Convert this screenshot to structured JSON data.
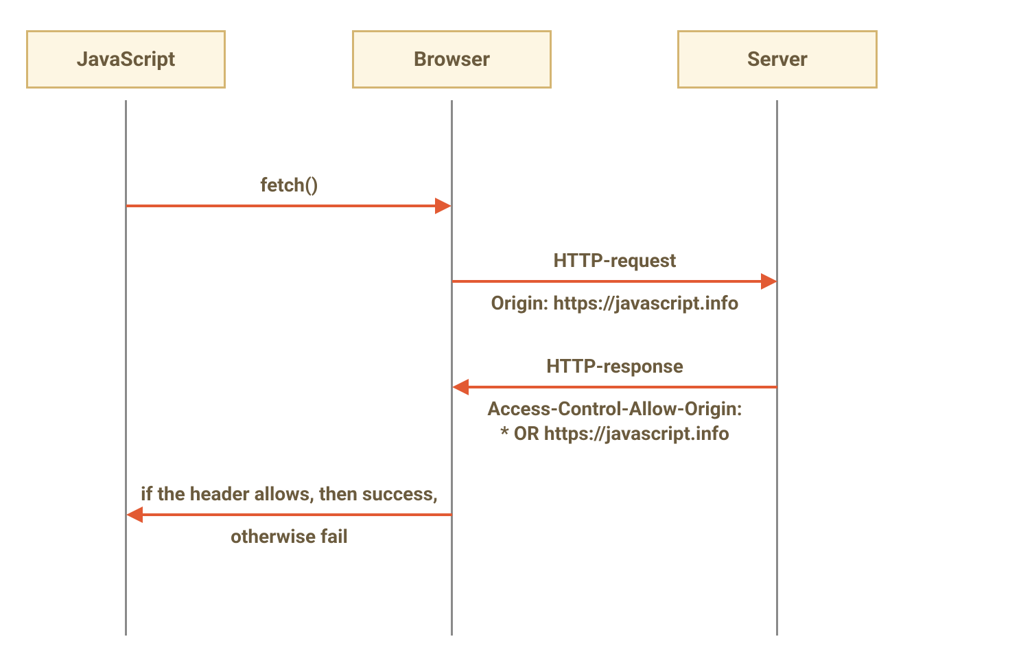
{
  "actors": {
    "javascript": "JavaScript",
    "browser": "Browser",
    "server": "Server"
  },
  "messages": {
    "fetch": "fetch()",
    "http_request": "HTTP-request",
    "origin": "Origin: https://javascript.info",
    "http_response": "HTTP-response",
    "acao_line1": "Access-Control-Allow-Origin:",
    "acao_line2": "* OR https://javascript.info",
    "success_line1": "if the header allows, then success,",
    "success_line2": "otherwise fail"
  },
  "colors": {
    "box_bg": "#fdf6e3",
    "box_border": "#d4b572",
    "text": "#6b5b3e",
    "arrow": "#e25a33",
    "lifeline": "#8a8a8a"
  }
}
